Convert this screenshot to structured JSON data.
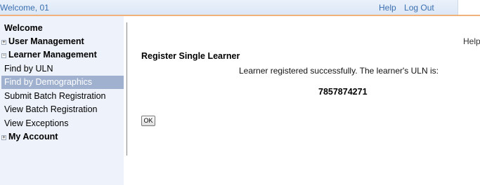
{
  "header": {
    "welcome": "Welcome, 01",
    "help": "Help",
    "logout": "Log Out"
  },
  "sidebar": {
    "items": [
      {
        "label": "Welcome"
      },
      {
        "label": "User Management",
        "expander": "+"
      },
      {
        "label": "Learner Management",
        "expander": "−"
      },
      {
        "label": "Find by ULN"
      },
      {
        "label": "Find by Demographics"
      },
      {
        "label": "Submit Batch Registration"
      },
      {
        "label": "View Batch Registration"
      },
      {
        "label": "View Exceptions"
      },
      {
        "label": "My Account",
        "expander": "+"
      }
    ]
  },
  "main": {
    "help": "Help",
    "title": "Register Single Learner",
    "message": "Learner registered successfully. The learner's ULN is:",
    "uln": "7857874271",
    "ok_label": "OK"
  },
  "colors": {
    "link": "#3a6fb0",
    "selected_bg": "#9fb1cf",
    "sidebar_bg": "#eef2fa",
    "header_border": "#f0b27a"
  }
}
